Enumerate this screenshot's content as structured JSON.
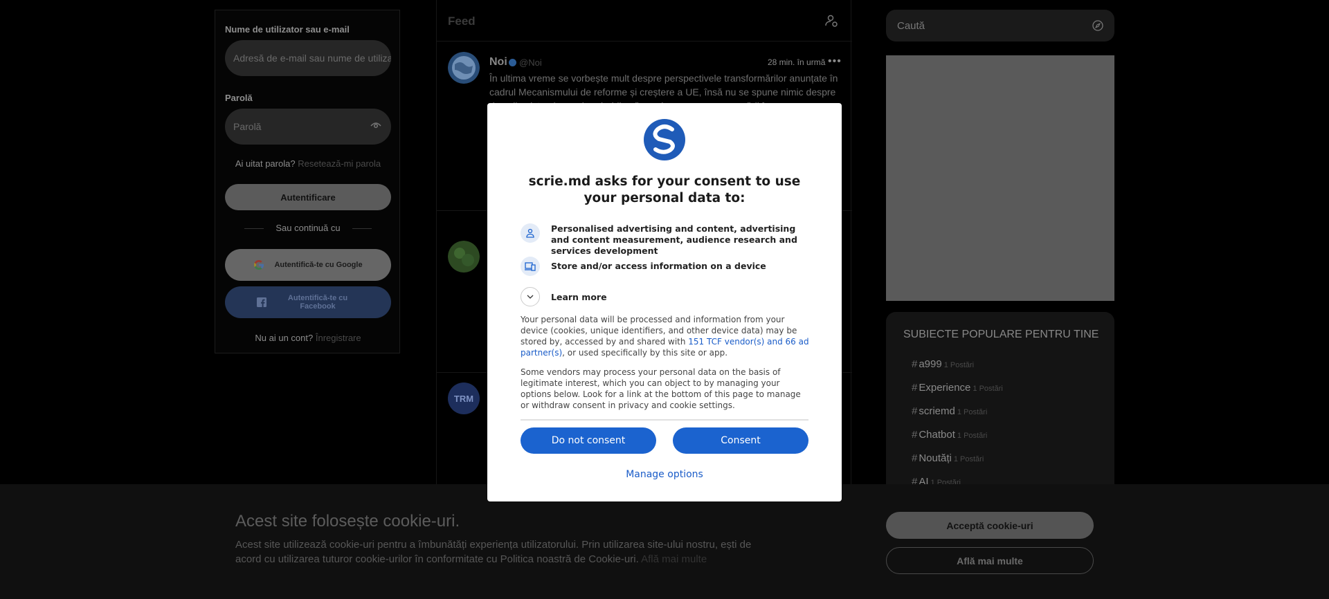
{
  "login": {
    "username_label": "Nume de utilizator sau e-mail",
    "username_placeholder": "Adresă de e-mail sau nume de utilizator",
    "password_label": "Parolă",
    "password_placeholder": "Parolă",
    "forgot_text": "Ai uitat parola?",
    "reset_link": "Resetează-mi parola",
    "login_button": "Autentificare",
    "or_continue": "Sau continuă cu",
    "google_button": "Autentifică-te cu Google",
    "facebook_button": "Autentifică-te cu Facebook",
    "no_account": "Nu ai un cont?",
    "register_link": "Înregistrare"
  },
  "feed": {
    "title": "Feed",
    "post": {
      "name": "Noi",
      "handle": "@Noi",
      "time": "28 min. în urmă",
      "more": "•••",
      "text": "În ultima vreme se vorbește mult despre perspectivele transformărilor anunțate în cadrul Mecanismului de reforme și creștere a UE, însă nu se spune nimic despre riscurile sistemice mai probabile să cuprinzeze guvernarea țării în"
    },
    "avatar3_text": "TRM"
  },
  "sidebar": {
    "search_placeholder": "Caută",
    "topics_title": "SUBIECTE POPULARE PENTRU TINE",
    "topics": [
      {
        "name": "a999",
        "count": "1 Postări"
      },
      {
        "name": "Experience",
        "count": "1 Postări"
      },
      {
        "name": "scriemd",
        "count": "1 Postări"
      },
      {
        "name": "Chatbot",
        "count": "1 Postări"
      },
      {
        "name": "Noutăți",
        "count": "1 Postări"
      },
      {
        "name": "AI",
        "count": "1 Postări"
      }
    ]
  },
  "cookie_bar": {
    "title": "Acest site folosește cookie-uri.",
    "text": "Acest site utilizează cookie-uri pentru a îmbunătăți experiența utilizatorului. Prin utilizarea site-ului nostru, ești de acord cu utilizarea tuturor cookie-urilor în conformitate cu Politica noastră de Cookie-uri.",
    "learn_link": "Află mai multe",
    "accept_button": "Acceptă cookie-uri",
    "more_button": "Află mai multe"
  },
  "consent": {
    "title": "scrie.md asks for your consent to use your personal data to:",
    "purpose1": "Personalised advertising and content, advertising and content measurement, audience research and services development",
    "purpose2": "Store and/or access information on a device",
    "learn_more": "Learn more",
    "para1_before": "Your personal data will be processed and information from your device (cookies, unique identifiers, and other device data) may be stored by, accessed by and shared with ",
    "para1_link": "151 TCF vendor(s) and 66 ad partner(s)",
    "para1_after": ", or used specifically by this site or app.",
    "para2": "Some vendors may process your personal data on the basis of legitimate interest, which you can object to by managing your options below. Look for a link at the bottom of this page to manage or withdraw consent in privacy and cookie settings.",
    "do_not_consent": "Do not consent",
    "consent": "Consent",
    "manage": "Manage options"
  },
  "colors": {
    "brand_blue": "#1b63cf",
    "background": "#000000"
  }
}
